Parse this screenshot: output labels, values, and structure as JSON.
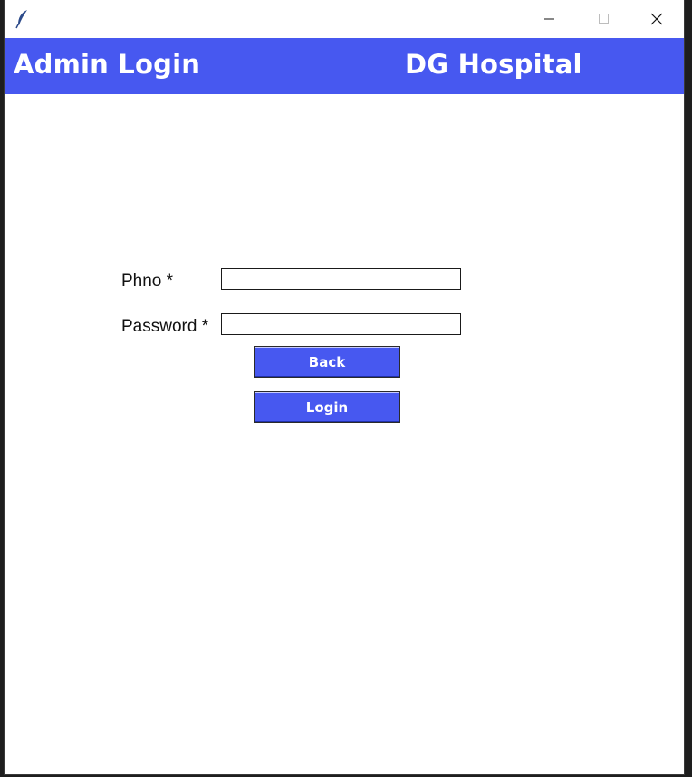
{
  "window": {
    "icon": "feather-icon",
    "controls": {
      "minimize": "minimize-icon",
      "maximize": "maximize-icon",
      "close": "close-icon"
    }
  },
  "header": {
    "title": "Admin Login",
    "brand": "DG Hospital",
    "bg_color": "#4758f0"
  },
  "form": {
    "phno_label": "Phno *",
    "phno_value": "",
    "password_label": "Password *",
    "password_value": ""
  },
  "buttons": {
    "back_label": "Back",
    "login_label": "Login",
    "color": "#4758f0"
  }
}
